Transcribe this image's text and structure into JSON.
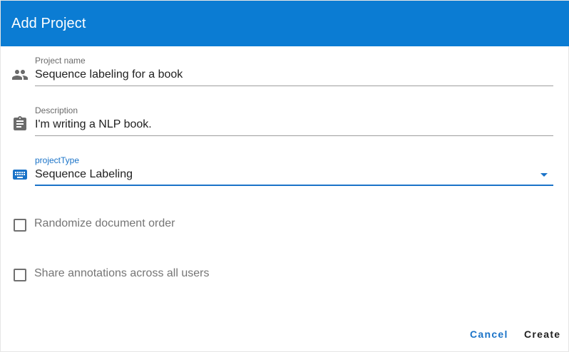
{
  "dialog": {
    "title": "Add Project"
  },
  "fields": {
    "project_name": {
      "label": "Project name",
      "value": "Sequence labeling for a book",
      "icon": "people-icon"
    },
    "description": {
      "label": "Description",
      "value": "I'm writing a NLP book.",
      "icon": "clipboard-icon"
    },
    "project_type": {
      "label": "projectType",
      "value": "Sequence Labeling",
      "icon": "keyboard-icon"
    }
  },
  "checkboxes": {
    "randomize": {
      "label": "Randomize document order",
      "checked": false
    },
    "share": {
      "label": "Share annotations across all users",
      "checked": false
    }
  },
  "actions": {
    "cancel_label": "Cancel",
    "create_label": "Create"
  },
  "colors": {
    "header": "#0b7cd3",
    "accent": "#1a73c8",
    "icon": "#6b6b6b"
  }
}
